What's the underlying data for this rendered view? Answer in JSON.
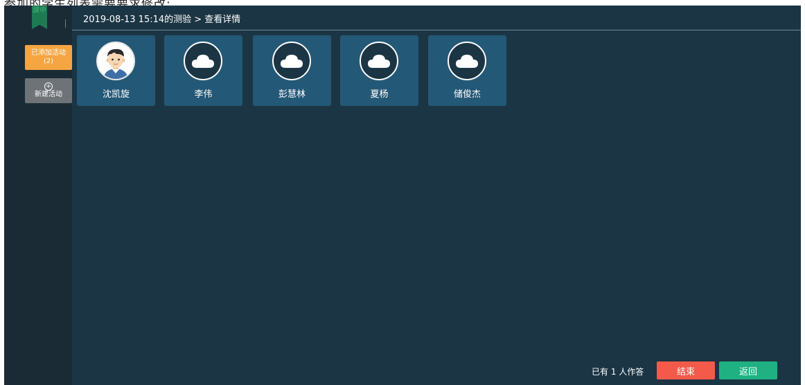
{
  "top_strip_text": "参加的学生列表需要要求修改:",
  "sidebar": {
    "logo_text": "課中",
    "added_activities_label": "已添加活动",
    "added_activities_count": "(2)",
    "new_activity_icon": "plus-circle-icon",
    "new_activity_label": "新建活动"
  },
  "header": {
    "breadcrumb": "2019-08-13 15:14的测验 > 查看详情"
  },
  "students": [
    {
      "name": "沈凯旋",
      "avatar": "boy-avatar"
    },
    {
      "name": "李伟",
      "avatar": "cloud-icon"
    },
    {
      "name": "彭慧林",
      "avatar": "cloud-icon"
    },
    {
      "name": "夏杨",
      "avatar": "cloud-icon"
    },
    {
      "name": "储俊杰",
      "avatar": "cloud-icon"
    }
  ],
  "footer": {
    "status_text": "已有 1 人作答",
    "end_label": "结束",
    "back_label": "返回"
  },
  "colors": {
    "main_bg": "#1b3544",
    "sidebar_bg": "#1b2b36",
    "card_bg": "#245877",
    "added_btn": "#f5a542",
    "new_btn": "#6e7378",
    "end_btn": "#f35a4a",
    "back_btn": "#20b183"
  }
}
